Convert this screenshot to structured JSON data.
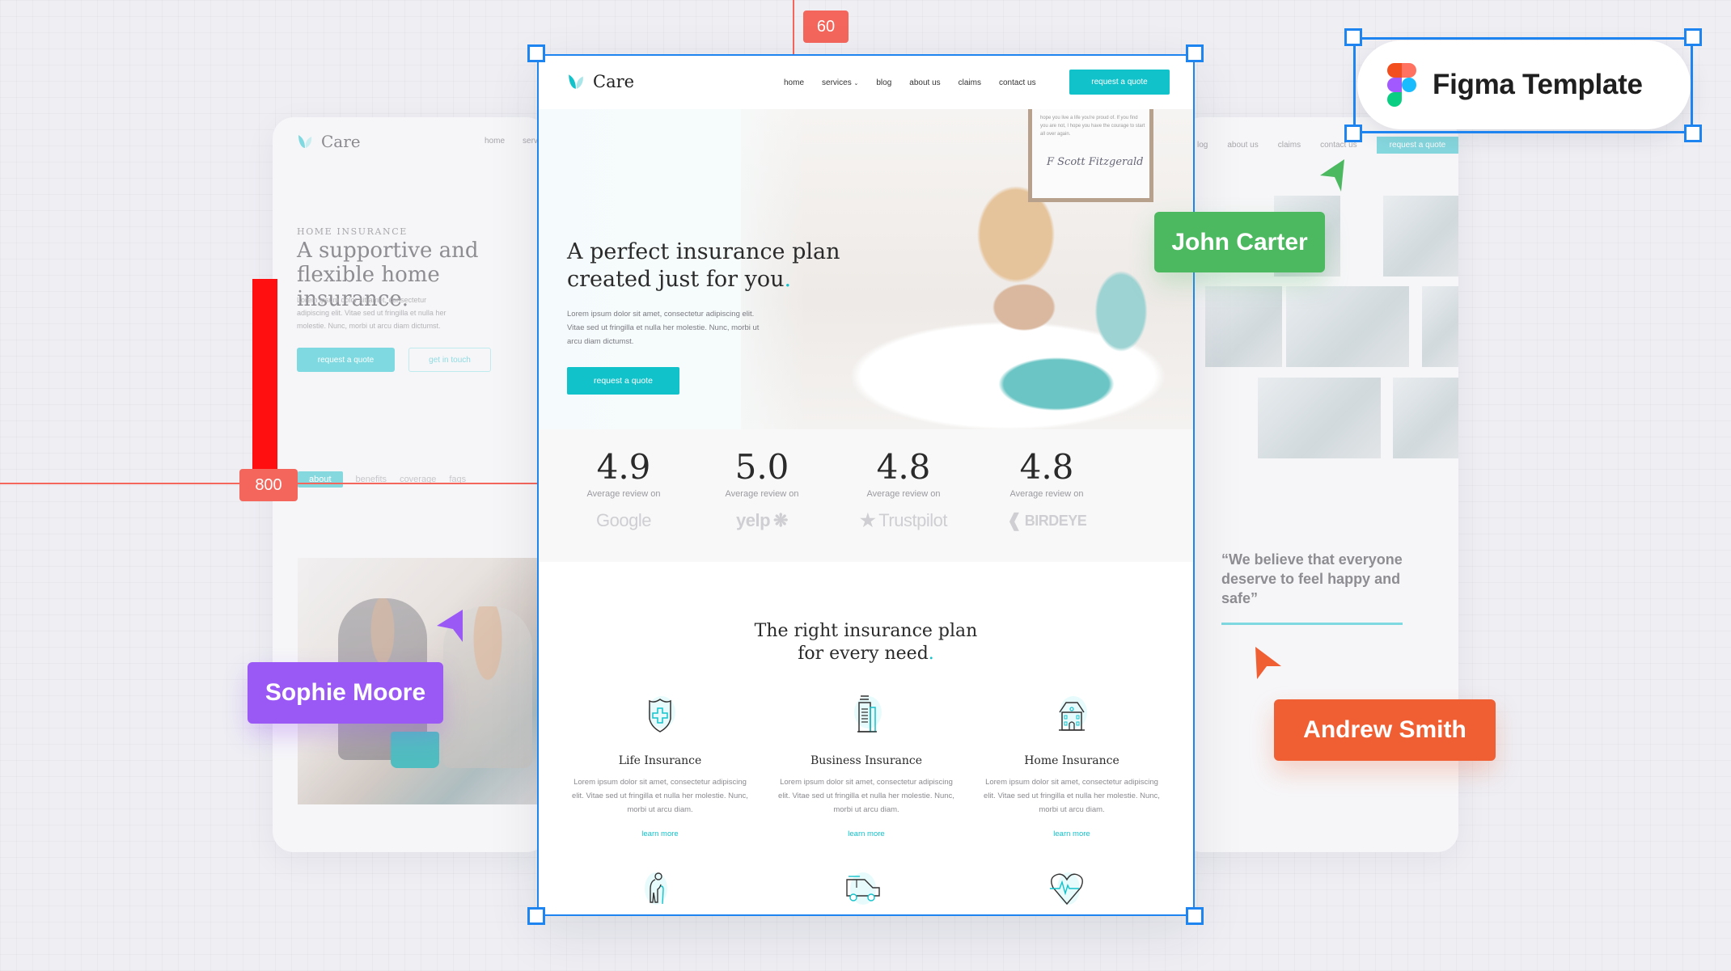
{
  "measurements": {
    "height_label": "800",
    "top_spacing_label": "60"
  },
  "figma_badge": {
    "label": "Figma Template",
    "icon": "figma-logo-icon"
  },
  "collaborators": [
    {
      "name": "John Carter",
      "color": "#4cb860"
    },
    {
      "name": "Sophie Moore",
      "color": "#9a59f5"
    },
    {
      "name": "Andrew Smith",
      "color": "#f05f33"
    }
  ],
  "left_card": {
    "logo": "Care",
    "nav": [
      "home",
      "serv"
    ],
    "kicker": "HOME INSURANCE",
    "title": "A supportive and flexible home insurance.",
    "body": "Lorem ipsum dolor sit amet, consectetur adipiscing elit. Vitae sed ut fringilla et nulla her molestie. Nunc, morbi ut arcu diam dictumst.",
    "primary_button": "request a quote",
    "secondary_button": "get in touch",
    "tabs": [
      "about",
      "benefits",
      "coverage",
      "faqs"
    ],
    "active_tab": "about"
  },
  "right_card": {
    "nav": [
      "log",
      "about us",
      "claims",
      "contact us"
    ],
    "cta": "request a quote",
    "quote": "“We believe that everyone deserve to feel happy and safe”"
  },
  "main": {
    "logo": "Care",
    "nav": {
      "links": [
        "home",
        "services",
        "blog",
        "about us",
        "claims",
        "contact us"
      ],
      "cta": "request a quote",
      "dropdown_indicator": "chevron-down-icon"
    },
    "hero": {
      "title_line1": "A perfect insurance plan",
      "title_line2": "created just for you",
      "title_dot": ".",
      "body": "Lorem ipsum dolor sit amet, consectetur adipiscing elit. Vitae sed ut fringilla et nulla her molestie. Nunc, morbi ut arcu diam dictumst.",
      "cta": "request a quote",
      "art_quote": "hope you live a life you're proud of. If you find you are not, I hope you have the courage to start all over again.",
      "art_signature": "F Scott Fitzgerald"
    },
    "reviews": [
      {
        "score": "4.9",
        "caption": "Average review on",
        "platform": "Google"
      },
      {
        "score": "5.0",
        "caption": "Average review on",
        "platform": "yelp"
      },
      {
        "score": "4.8",
        "caption": "Average review on",
        "platform": "Trustpilot"
      },
      {
        "score": "4.8",
        "caption": "Average review on",
        "platform": "BIRDEYE"
      }
    ],
    "section": {
      "title_line1": "The right insurance plan",
      "title_line2": "for every need",
      "title_dot": "."
    },
    "services": [
      {
        "name": "Life Insurance",
        "icon": "shield-cross-icon",
        "desc": "Lorem ipsum dolor sit amet, consectetur adipiscing elit. Vitae sed ut fringilla et nulla her molestie. Nunc, morbi ut arcu diam.",
        "link": "learn more"
      },
      {
        "name": "Business Insurance",
        "icon": "office-building-icon",
        "desc": "Lorem ipsum dolor sit amet, consectetur adipiscing elit. Vitae sed ut fringilla et nulla her molestie. Nunc, morbi ut arcu diam.",
        "link": "learn more"
      },
      {
        "name": "Home Insurance",
        "icon": "house-icon",
        "desc": "Lorem ipsum dolor sit amet, consectetur adipiscing elit. Vitae sed ut fringilla et nulla her molestie. Nunc, morbi ut arcu diam.",
        "link": "learn more"
      }
    ],
    "more_services_icons": [
      "elderly-person-icon",
      "car-icon",
      "heartbeat-icon"
    ]
  },
  "colors": {
    "accent": "#12c2cb",
    "selection": "#1e85f0",
    "measure": "#f4665c"
  }
}
